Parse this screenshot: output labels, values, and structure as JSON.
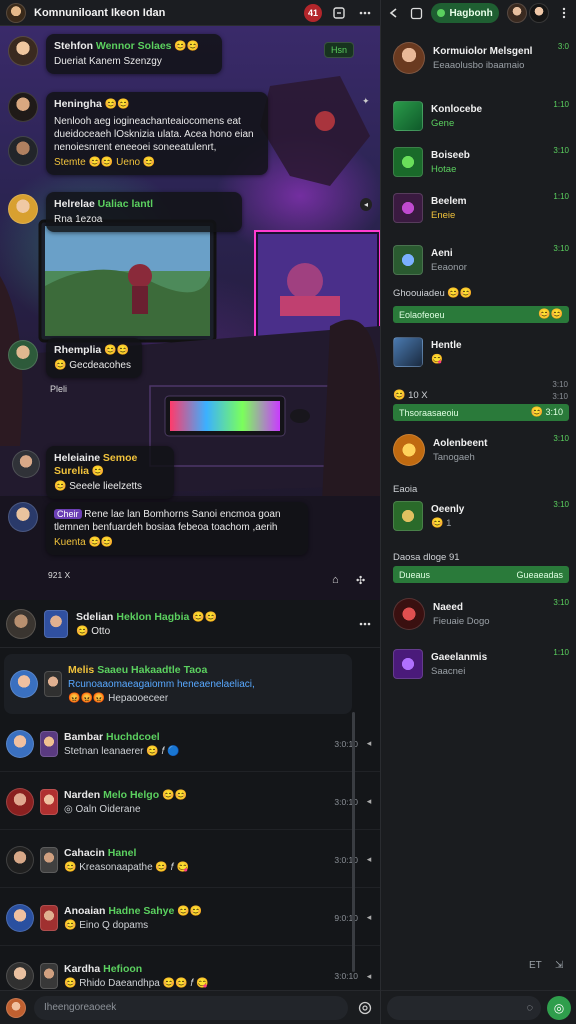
{
  "colors": {
    "accent_green": "#2f9e4c",
    "badge_red": "#b3262b",
    "panel_bg": "#15171a"
  },
  "topbar": {
    "title": "Komnuniloant Ikeon Idan",
    "badge": "41"
  },
  "scene_messages": [
    {
      "name": "Stehfon",
      "name2": "Wennor Solaes",
      "text": "Dueriat Kanem Szenzgy",
      "tag": "Hsn"
    },
    {
      "name": "Heningha",
      "text": "Nenlooh aeg iogineachanteaiocomens eat dueidoceaeh lOsknizia ulata. Acea hono eian nenoiesnrent eneeoei soneeatulenrt,",
      "text2": "Stemte",
      "text3": "Ueno",
      "time": ""
    },
    {
      "name": "Helrelae",
      "name2": "Ualiac lantl",
      "text": "Rna 1ezoa"
    },
    {
      "name": "Rhemplia",
      "text": "Gecdeacohes",
      "extra": "Pleli"
    },
    {
      "name": "Heleiaine",
      "name2": "Semoe Surelia",
      "text": "Seeele lieelzetts"
    },
    {
      "name": "Cheir",
      "text": "Rene lae lan Bomhorns Sanoi encmoa goan tlemnen benfuardeh bosiaa febeoa toachom ,aerih",
      "text2": "Kuenta",
      "time": "921 X"
    }
  ],
  "pinned": {
    "name": "Sdelian",
    "name2": "Heklon Hagbia",
    "text": "Otto"
  },
  "rows": [
    {
      "name": "Melis",
      "name2": "Saaeu Hakaadtle Taoa",
      "text": "Rcunoaaomaeagaiomm heneaenelaeliaci,",
      "text2": "Hepaooeceer",
      "time": ""
    },
    {
      "name": "Bambar",
      "name2": "Huchdcoel",
      "text": "Stetnan leanaerer",
      "time": "3:0:10"
    },
    {
      "name": "Narden",
      "name2": "Melo Helgo",
      "text": "Oaln Oiderane",
      "time": "3:0:10"
    },
    {
      "name": "Cahacin",
      "name2": "Hanel",
      "text": "Kreasonaapathe",
      "time": "3:0:10"
    },
    {
      "name": "Anoaian",
      "name2": "Hadne Sahye",
      "text": "Eino  Q dopams",
      "time": "9:0:10"
    },
    {
      "name": "Kardha",
      "name2": "Hefioon",
      "text": "Rhido Daeandhpa",
      "time": "3:0:10"
    }
  ],
  "composer_left": {
    "placeholder": "Iheengoreaoeek"
  },
  "right": {
    "pill_label": "Hagbonh",
    "contacts": [
      {
        "name": "Kormuiolor Melsgenl",
        "sub": "Eeaaolusbo ibaamaio",
        "time": "3:0"
      },
      {
        "name": "Konlocebe",
        "sub": "Gene",
        "time": "1:10"
      },
      {
        "name": "Boiseeb",
        "sub": "Hotae",
        "time": "3:10"
      },
      {
        "name": "Beelem",
        "sub": "Eneie",
        "time": "1:10"
      },
      {
        "name": "Aeni",
        "sub": "Eeaonor",
        "time": "3:10"
      },
      {
        "name": "Hentle",
        "sub": "",
        "time": ""
      },
      {
        "name": "Aolenbeent",
        "sub": "Tanogaeh",
        "time": "3:10"
      },
      {
        "name": "Oeenly",
        "sub": "1",
        "time": "3:10"
      },
      {
        "name": "Naeed",
        "sub": "Fieuaie Dogo",
        "time": "3:10"
      },
      {
        "name": "Gaeelanmis",
        "sub": "Saacnei",
        "time": "1:10"
      }
    ],
    "label1": "Ghoouiadeu",
    "bar1": "Eolaofeoeu",
    "small1": "3:10",
    "label2": "10 X",
    "small2": "3:10",
    "bar2": "Thsoraasaeoiu",
    "bar2_time": "3:10",
    "label3": "Eaoia",
    "label4": "Daosa dloge 91",
    "bar3": "Dueaus",
    "bar3_right": "Gueaeadas",
    "footer": "ET"
  }
}
